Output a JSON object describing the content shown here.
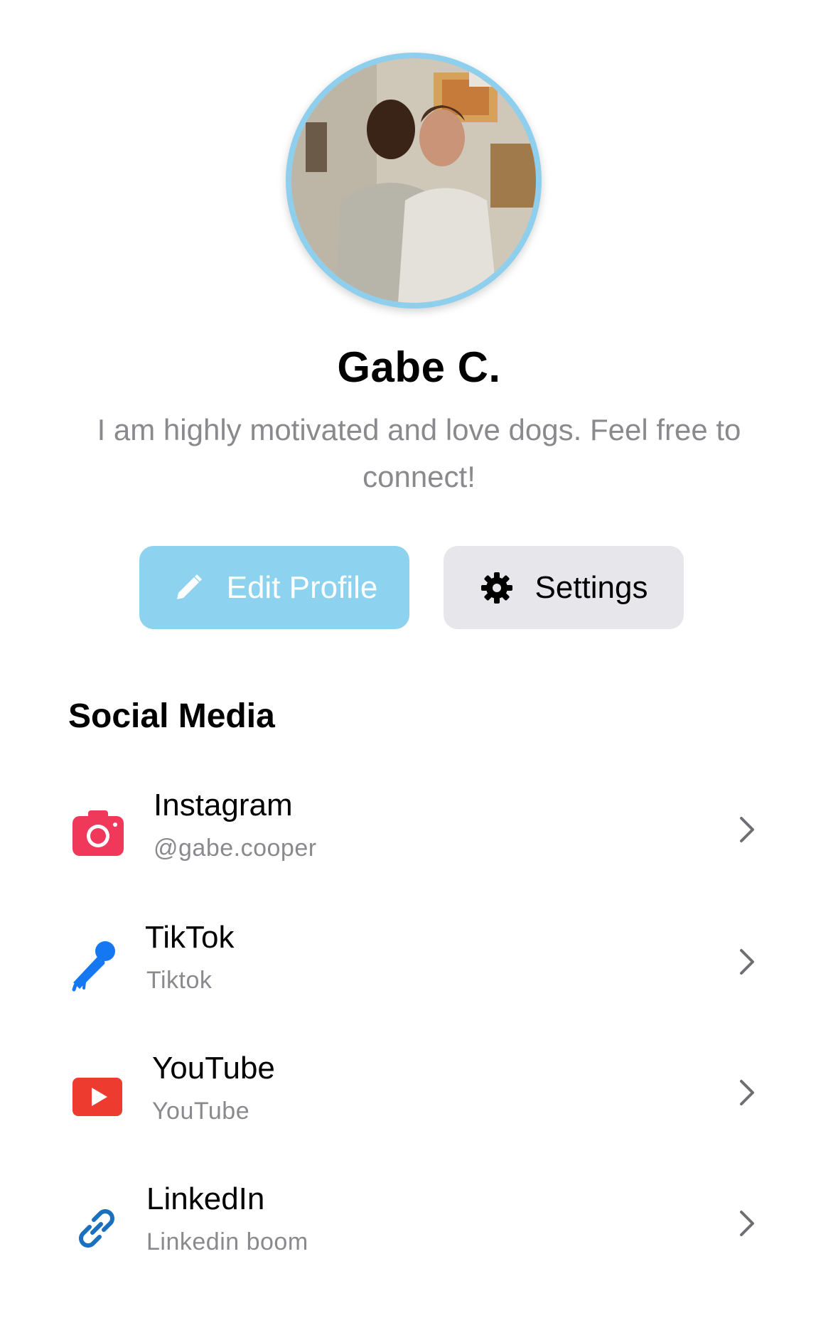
{
  "profile": {
    "name": "Gabe C.",
    "bio": "I am highly motivated and love dogs. Feel free to connect!"
  },
  "actions": {
    "edit_label": "Edit Profile",
    "settings_label": "Settings"
  },
  "social": {
    "title": "Social Media",
    "items": [
      {
        "title": "Instagram",
        "subtitle": "@gabe.cooper",
        "icon": "camera-icon",
        "color": "#f0385a"
      },
      {
        "title": "TikTok",
        "subtitle": "Tiktok",
        "icon": "microphone-icon",
        "color": "#1677f2"
      },
      {
        "title": "YouTube",
        "subtitle": "YouTube",
        "icon": "play-icon",
        "color": "#ee3b2f"
      },
      {
        "title": "LinkedIn",
        "subtitle": "Linkedin boom",
        "icon": "link-icon",
        "color": "#1a6fbf"
      }
    ]
  },
  "colors": {
    "accent": "#8dd3f0",
    "secondary_button": "#e6e6eb",
    "muted_text": "#8a8a8e"
  }
}
